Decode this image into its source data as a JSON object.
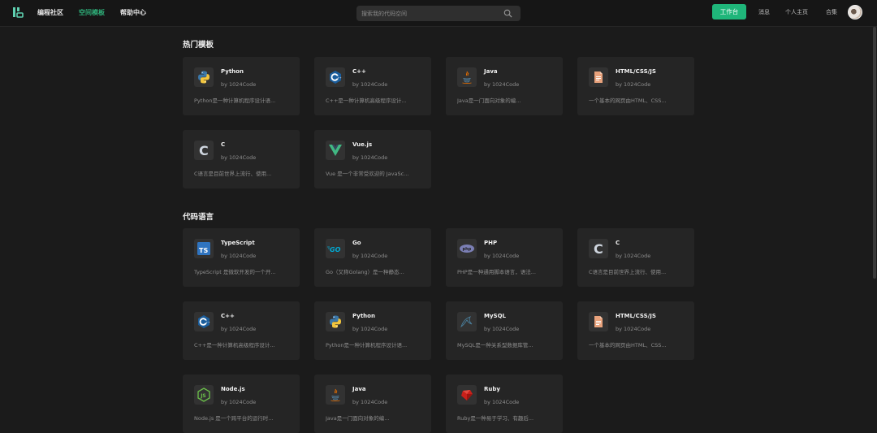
{
  "nav": {
    "items": [
      "编程社区",
      "空间模板",
      "帮助中心"
    ],
    "active_index": 1
  },
  "search": {
    "placeholder": "搜索我的代码空间"
  },
  "header_right": {
    "workbench_label": "工作台",
    "messages_label": "消息",
    "profile_label": "个人主页",
    "collection_label": "合集"
  },
  "colors": {
    "accent": "#1fb67a",
    "active_nav": "#2fb07a",
    "background": "#1b1b1b",
    "card": "#252525"
  },
  "sections": [
    {
      "title": "热门模板",
      "cards": [
        {
          "name": "Python",
          "author": "by 1024Code",
          "desc": "Python是一种计算机程序设计语...",
          "icon": "python-icon"
        },
        {
          "name": "C++",
          "author": "by 1024Code",
          "desc": "C++是一种计算机高级程序设计...",
          "icon": "cpp-icon"
        },
        {
          "name": "Java",
          "author": "by 1024Code",
          "desc": "Java是一门面向对象的编...",
          "icon": "java-icon"
        },
        {
          "name": "HTML/CSS/JS",
          "author": "by 1024Code",
          "desc": "一个基本的网页由HTML、CSS...",
          "icon": "html-icon"
        },
        {
          "name": "C",
          "author": "by 1024Code",
          "desc": "C语言是目前世界上流行、使用...",
          "icon": "c-icon"
        },
        {
          "name": "Vue.js",
          "author": "by 1024Code",
          "desc": "Vue 是一个非常受欢迎的 JavaSc...",
          "icon": "vue-icon"
        }
      ]
    },
    {
      "title": "代码语言",
      "cards": [
        {
          "name": "TypeScript",
          "author": "by 1024Code",
          "desc": "TypeScript 是微软开发的一个开...",
          "icon": "typescript-icon"
        },
        {
          "name": "Go",
          "author": "by 1024Code",
          "desc": "Go（又称Golang）是一种静态...",
          "icon": "go-icon"
        },
        {
          "name": "PHP",
          "author": "by 1024Code",
          "desc": "PHP是一种通用脚本语言，语法...",
          "icon": "php-icon"
        },
        {
          "name": "C",
          "author": "by 1024Code",
          "desc": "C语言是目前世界上流行、使用...",
          "icon": "c-icon"
        },
        {
          "name": "C++",
          "author": "by 1024Code",
          "desc": "C++是一种计算机高级程序设计...",
          "icon": "cpp-icon"
        },
        {
          "name": "Python",
          "author": "by 1024Code",
          "desc": "Python是一种计算机程序设计语...",
          "icon": "python-icon"
        },
        {
          "name": "MySQL",
          "author": "by 1024Code",
          "desc": "MySQL是一种关系型数据库管...",
          "icon": "mysql-icon"
        },
        {
          "name": "HTML/CSS/JS",
          "author": "by 1024Code",
          "desc": "一个基本的网页由HTML、CSS...",
          "icon": "html-icon"
        },
        {
          "name": "Node.js",
          "author": "by 1024Code",
          "desc": "Node.js 是一个跨平台的运行时...",
          "icon": "nodejs-icon"
        },
        {
          "name": "Java",
          "author": "by 1024Code",
          "desc": "Java是一门面向对象的编...",
          "icon": "java-icon"
        },
        {
          "name": "Ruby",
          "author": "by 1024Code",
          "desc": "Ruby是一种易于学习、有趣后...",
          "icon": "ruby-icon"
        }
      ]
    }
  ]
}
